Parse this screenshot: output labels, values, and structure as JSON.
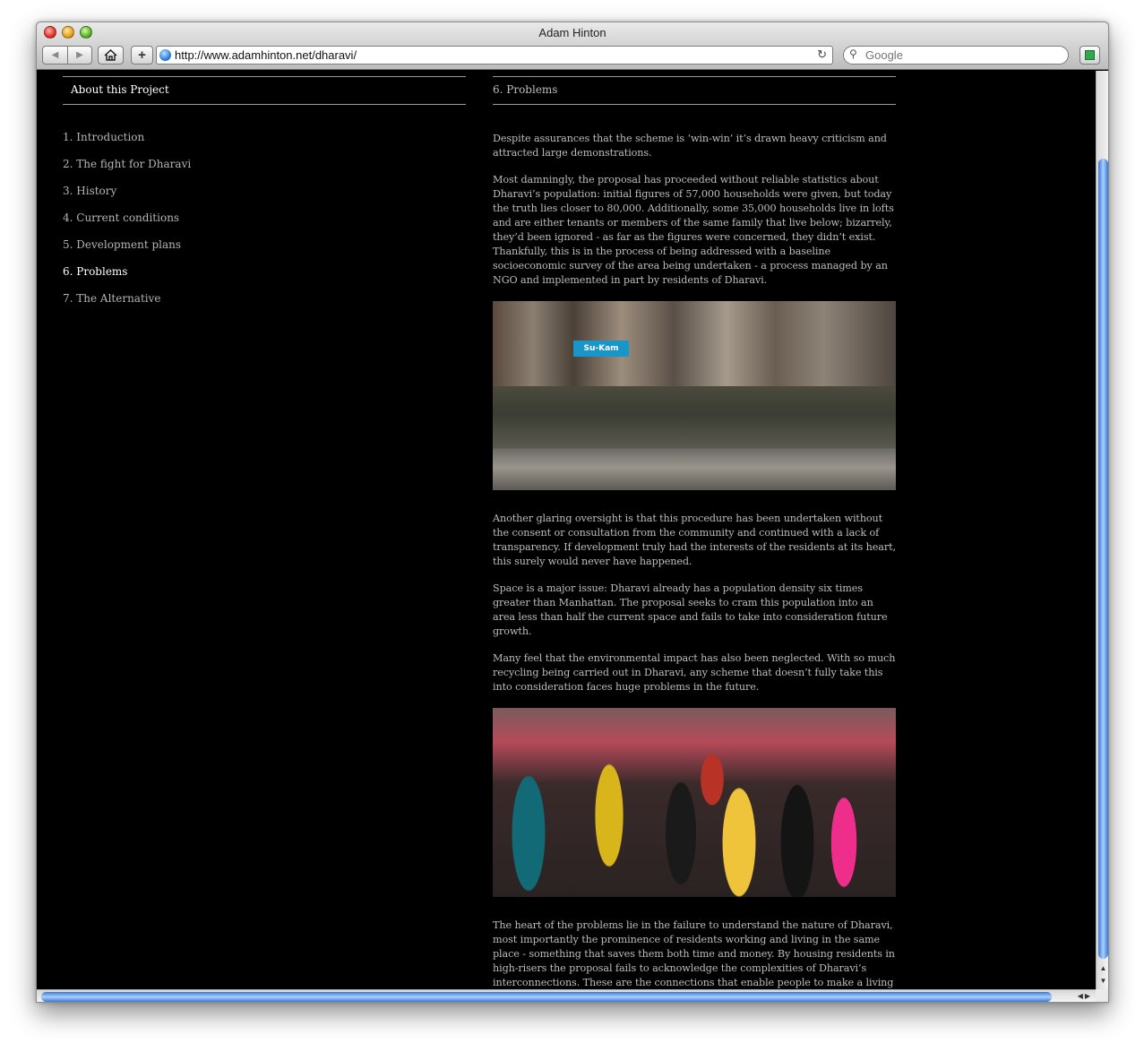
{
  "window": {
    "title": "Adam Hinton"
  },
  "toolbar": {
    "url": "http://www.adamhinton.net/dharavi/",
    "search_placeholder": "Google",
    "back_label": "◀",
    "forward_label": "▶",
    "add_label": "+",
    "reload_label": "↻"
  },
  "sidebar": {
    "heading": "About this Project",
    "items": [
      {
        "label": "1. Introduction"
      },
      {
        "label": "2. The fight for Dharavi"
      },
      {
        "label": "3. History"
      },
      {
        "label": "4. Current conditions"
      },
      {
        "label": "5. Development plans"
      },
      {
        "label": "6. Problems",
        "active": true
      },
      {
        "label": "7. The Alternative"
      }
    ]
  },
  "article": {
    "heading": "6. Problems",
    "paragraphs": [
      "Despite assurances that the scheme is ‘win-win’ it’s drawn heavy criticism and attracted large demonstrations.",
      "Most damningly, the proposal has proceeded without reliable statistics about Dharavi’s population: initial figures of 57,000 households were given, but today the truth lies closer to 80,000. Additionally, some 35,000 households live in lofts and are either tenants or members of the same family that live below; bizarrely, they’d been ignored - as far as the figures were concerned, they didn’t exist. Thankfully, this is in the process of being addressed with a baseline socioeconomic survey of the area being undertaken - a process managed by an NGO and implemented in part by residents of Dharavi.",
      "Another glaring oversight is that this procedure has been undertaken without the consent or consultation from the community and continued with a lack of transparency. If development truly had the interests of the residents at its heart, this surely would never have happened.",
      "Space is a major issue: Dharavi already has a population density six times greater than Manhattan. The proposal seeks to cram this population into an area less than half the current space and fails to take into consideration future growth.",
      "Many feel that the environmental impact has also been neglected. With so much recycling being carried out in Dharavi, any scheme that doesn’t fully take this into consideration faces huge problems in the future.",
      "The heart of the problems lie in the failure to understand the nature of Dharavi, most importantly the prominence of residents working and living in the same place - something that saves them both time and money. By housing residents in high-risers the proposal fails to acknowledge the complexities of Dharavi’s interconnections. These are the connections that enable people to make a living and failure to incorporate this will only lead Dharavi’s future to disaster."
    ],
    "photo1_sign": "Su-Kam",
    "next_link": ">>"
  },
  "colors": {
    "background": "#000000",
    "active_nav": "#ffffff",
    "text": "#bcbcbc",
    "scroll_thumb": "#3b78d6"
  }
}
